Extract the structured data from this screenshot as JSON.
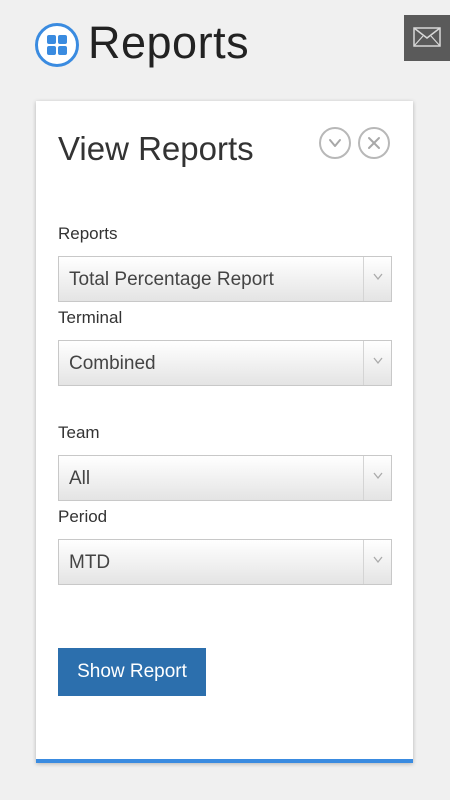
{
  "header": {
    "title": "Reports",
    "app_icon": "grid-icon",
    "mail_icon": "mail-icon"
  },
  "card": {
    "title": "View Reports",
    "collapse_icon": "chevron-down-icon",
    "close_icon": "close-icon",
    "fields": [
      {
        "label": "Reports",
        "value": "Total Percentage Report"
      },
      {
        "label": "Terminal",
        "value": "Combined"
      },
      {
        "label": "Team",
        "value": "All"
      },
      {
        "label": "Period",
        "value": "MTD"
      }
    ],
    "show_button_label": "Show Report"
  },
  "colors": {
    "accent": "#3a8be0",
    "button": "#2c6fad",
    "mail_button": "#5a5a5a",
    "background": "#f0f0f0"
  }
}
